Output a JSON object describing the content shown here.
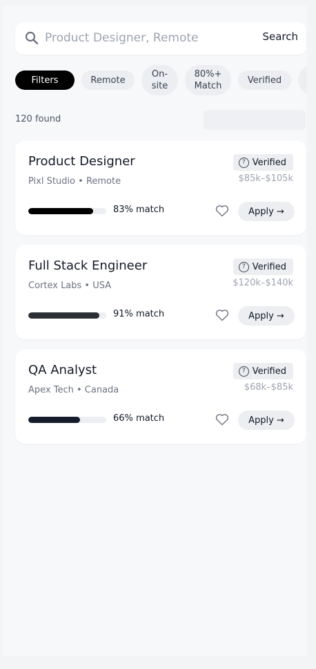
{
  "search": {
    "placeholder": "Product Designer, Remote",
    "button_label": "Search"
  },
  "filters": [
    {
      "label": "Filters",
      "active": true
    },
    {
      "label": "Remote",
      "active": false
    },
    {
      "label": "On-\nsite",
      "active": false
    },
    {
      "label": "80%+\nMatch",
      "active": false
    },
    {
      "label": "Verified",
      "active": false
    }
  ],
  "results": {
    "count_label": "120 found"
  },
  "jobs": [
    {
      "title": "Product Designer",
      "company_location": "Pixl Studio • Remote",
      "badge": "Verified",
      "salary": "$85k–$105k",
      "match_label": "83% match",
      "match": 0.83,
      "bar_color": "#000000",
      "apply_label": "Apply →"
    },
    {
      "title": "Full Stack Engineer",
      "company_location": "Cortex Labs • USA",
      "badge": "Verified",
      "salary": "$120k–$140k",
      "match_label": "91% match",
      "match": 0.91,
      "bar_color": "#2b2f33",
      "apply_label": "Apply →"
    },
    {
      "title": "QA Analyst",
      "company_location": "Apex Tech • Canada",
      "badge": "Verified",
      "salary": "$68k–$85k",
      "match_label": "66% match",
      "match": 0.66,
      "bar_color": "#151c2c",
      "apply_label": "Apply →"
    }
  ],
  "icons": {
    "search": "search-icon",
    "verified": "question-circle-icon",
    "save": "heart-icon"
  }
}
